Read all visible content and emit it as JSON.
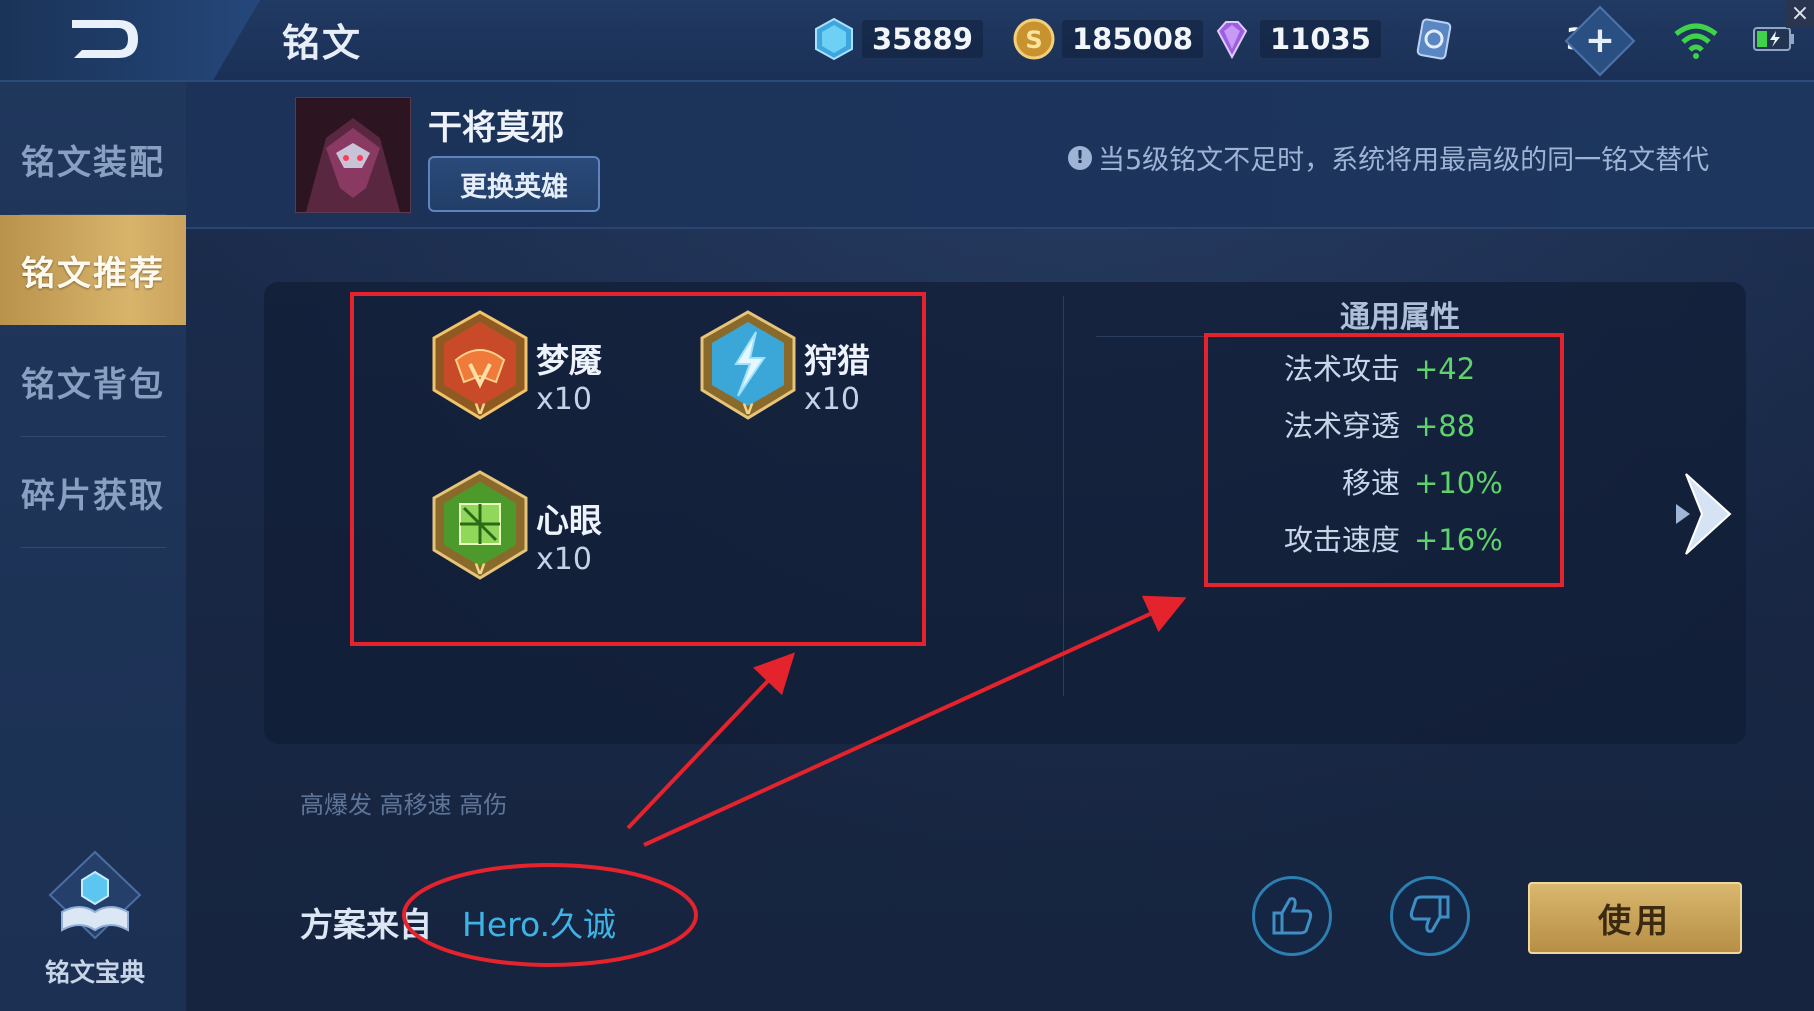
{
  "header": {
    "title": "铭文",
    "currencies": {
      "diamond": "35889",
      "gold": "185008",
      "gem": "11035",
      "ticket": "3"
    }
  },
  "sidebar": {
    "items": [
      {
        "label": "铭文装配"
      },
      {
        "label": "铭文推荐"
      },
      {
        "label": "铭文背包"
      },
      {
        "label": "碎片获取"
      }
    ],
    "codex_label": "铭文宝典"
  },
  "hero": {
    "name": "干将莫邪",
    "change_button": "更换英雄",
    "notice": "当5级铭文不足时，系统将用最高级的同一铭文替代"
  },
  "runes": [
    {
      "name": "梦魇",
      "count": "x10",
      "color": "#c84a28"
    },
    {
      "name": "狩猎",
      "count": "x10",
      "color": "#3aa7d8"
    },
    {
      "name": "心眼",
      "count": "x10",
      "color": "#4c9a2c"
    }
  ],
  "attributes": {
    "title": "通用属性",
    "items": [
      {
        "key": "法术攻击",
        "value": "+42"
      },
      {
        "key": "法术穿透",
        "value": "+88"
      },
      {
        "key": "移速",
        "value": "+10%"
      },
      {
        "key": "攻击速度",
        "value": "+16%"
      }
    ]
  },
  "footer": {
    "tags": "高爆发 高移速 高伤",
    "source_label": "方案来自",
    "source_name": "Hero.久诚",
    "use_button": "使用"
  },
  "colors": {
    "accent_gold": "#d8b46b",
    "annotation_red": "#e5232c",
    "stat_green": "#5ed26b",
    "link_blue": "#3fb3e6"
  }
}
